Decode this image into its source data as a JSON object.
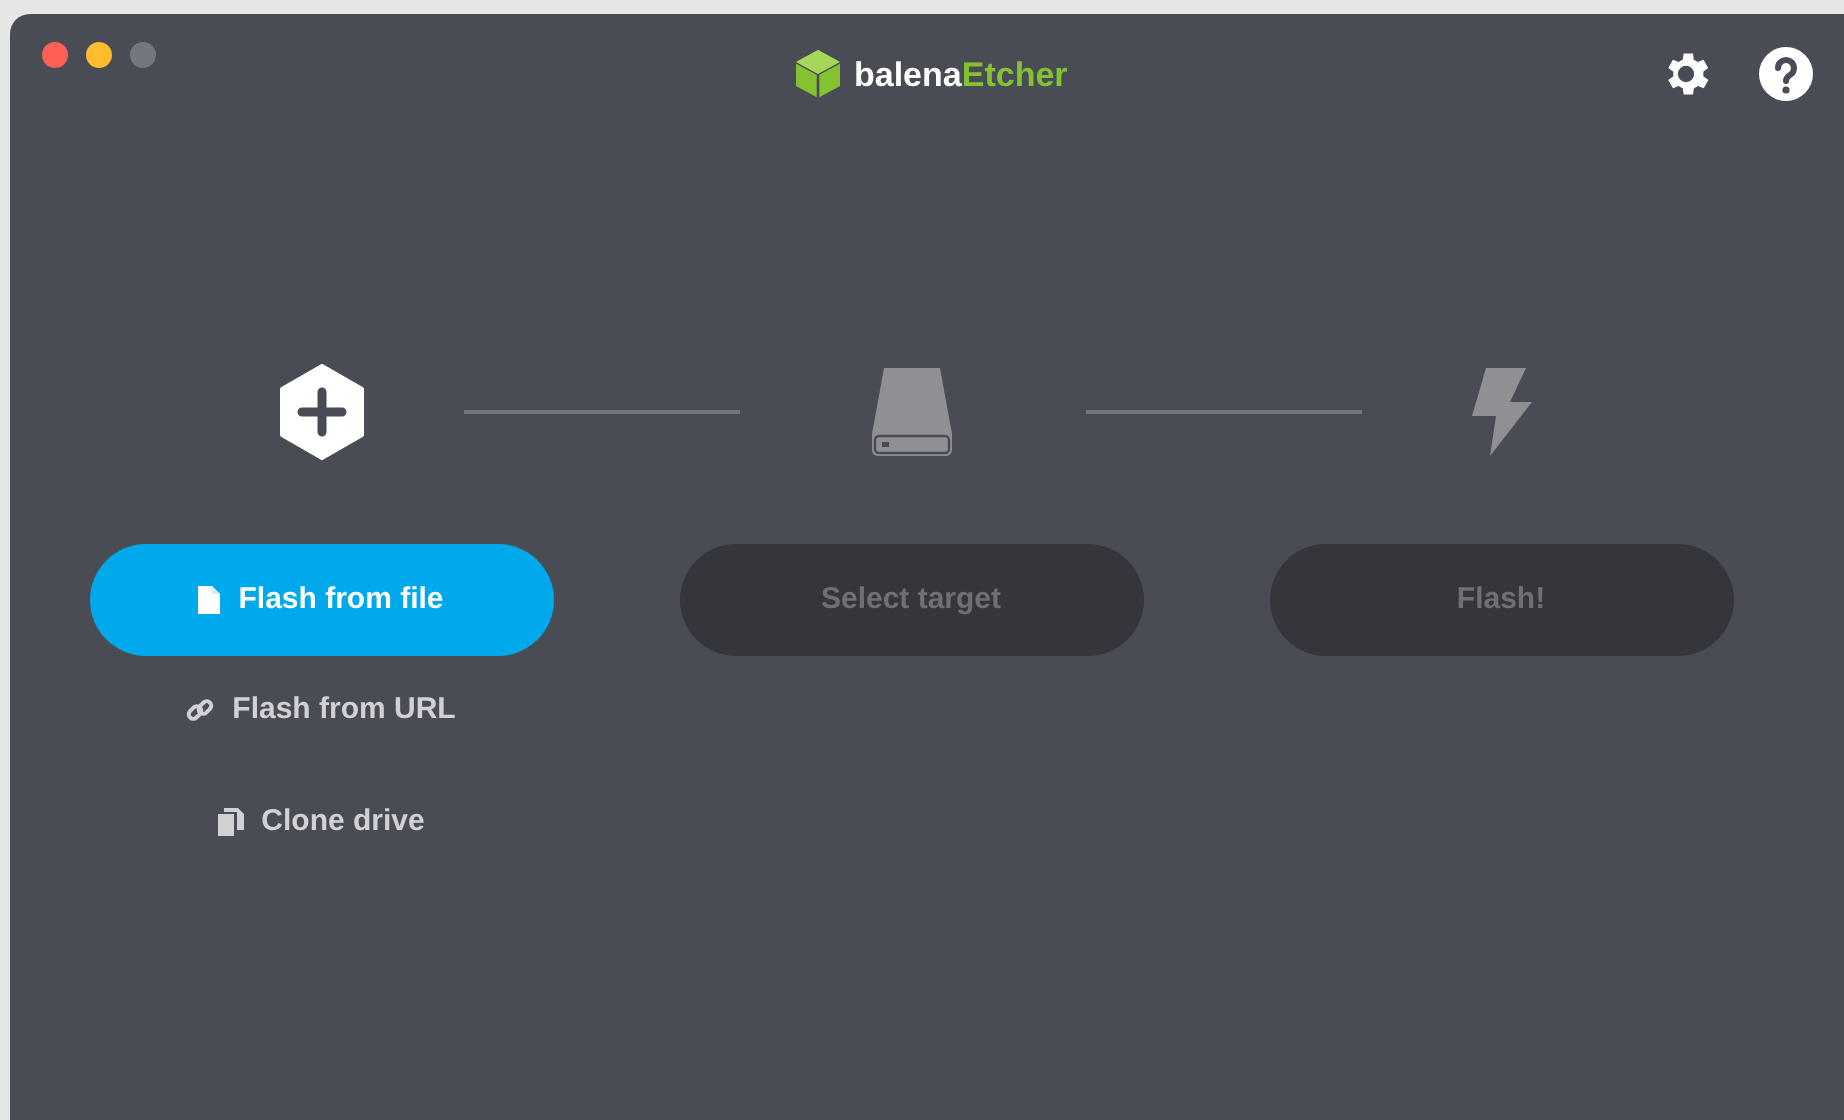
{
  "header": {
    "brand": "balena",
    "product": "Etcher"
  },
  "steps": [
    {
      "kind": "source",
      "label": "Flash from file",
      "disabled": false
    },
    {
      "kind": "target",
      "label": "Select target",
      "disabled": true
    },
    {
      "kind": "flash",
      "label": "Flash!",
      "disabled": true
    }
  ],
  "source_options": [
    {
      "kind": "url",
      "label": "Flash from URL"
    },
    {
      "kind": "clone",
      "label": "Clone drive"
    }
  ]
}
